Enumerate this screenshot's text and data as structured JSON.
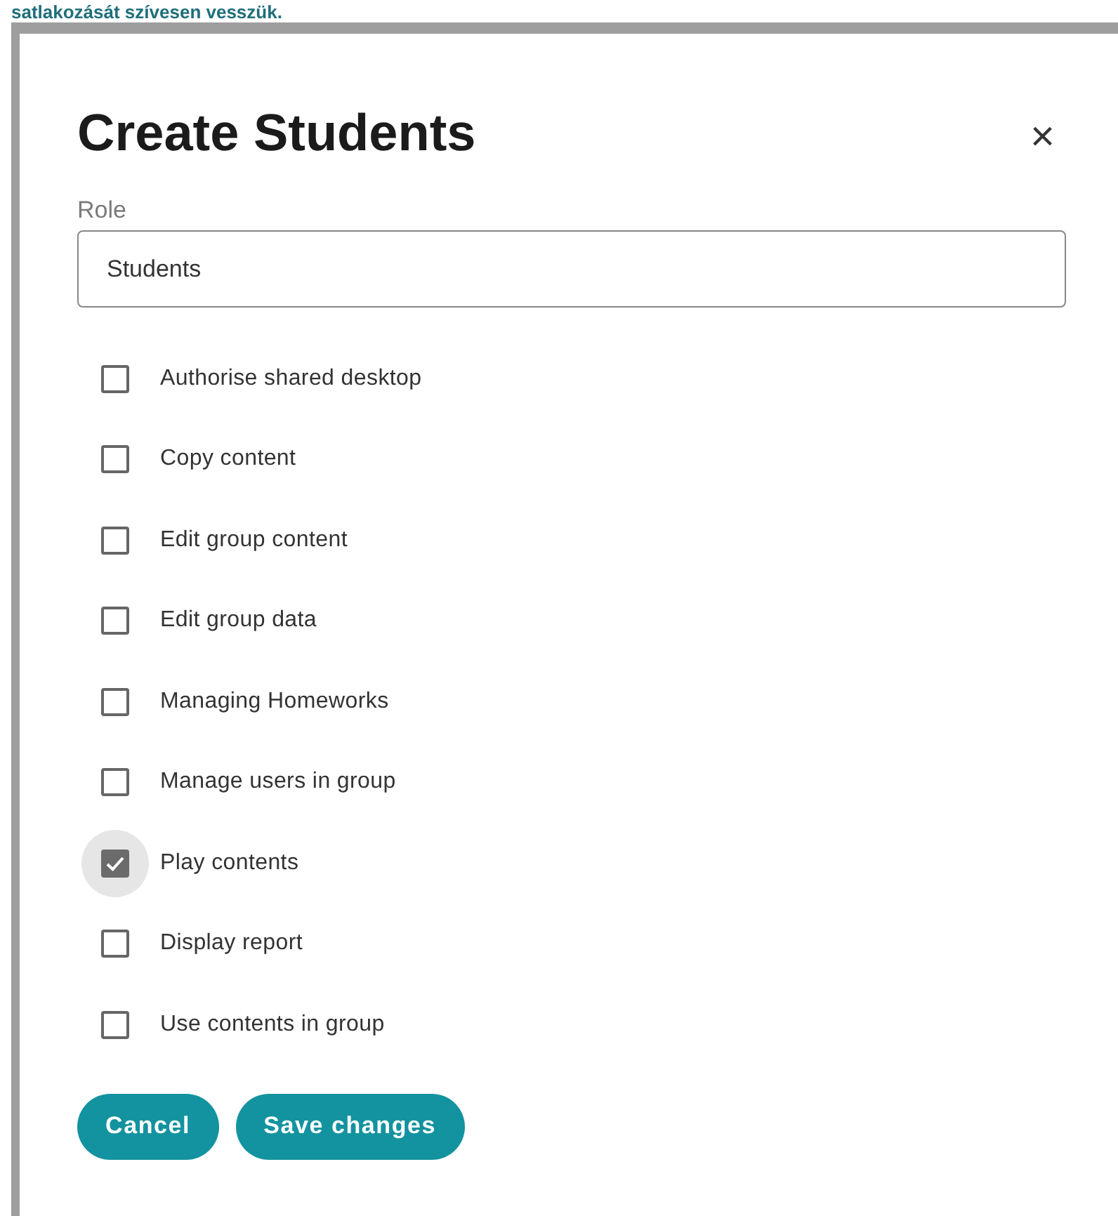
{
  "background": {
    "text": "satlakozását szívesen vesszük."
  },
  "dialog": {
    "title": "Create Students",
    "close": "×",
    "role_field": {
      "label": "Role",
      "value": "Students"
    },
    "permissions": [
      {
        "label": "Authorise shared desktop",
        "checked": false
      },
      {
        "label": "Copy content",
        "checked": false
      },
      {
        "label": "Edit group content",
        "checked": false
      },
      {
        "label": "Edit group data",
        "checked": false
      },
      {
        "label": "Managing Homeworks",
        "checked": false
      },
      {
        "label": "Manage users in group",
        "checked": false
      },
      {
        "label": "Play contents",
        "checked": true
      },
      {
        "label": "Display report",
        "checked": false
      },
      {
        "label": "Use contents in group",
        "checked": false
      }
    ],
    "buttons": [
      "Cancel",
      "Save changes"
    ]
  }
}
